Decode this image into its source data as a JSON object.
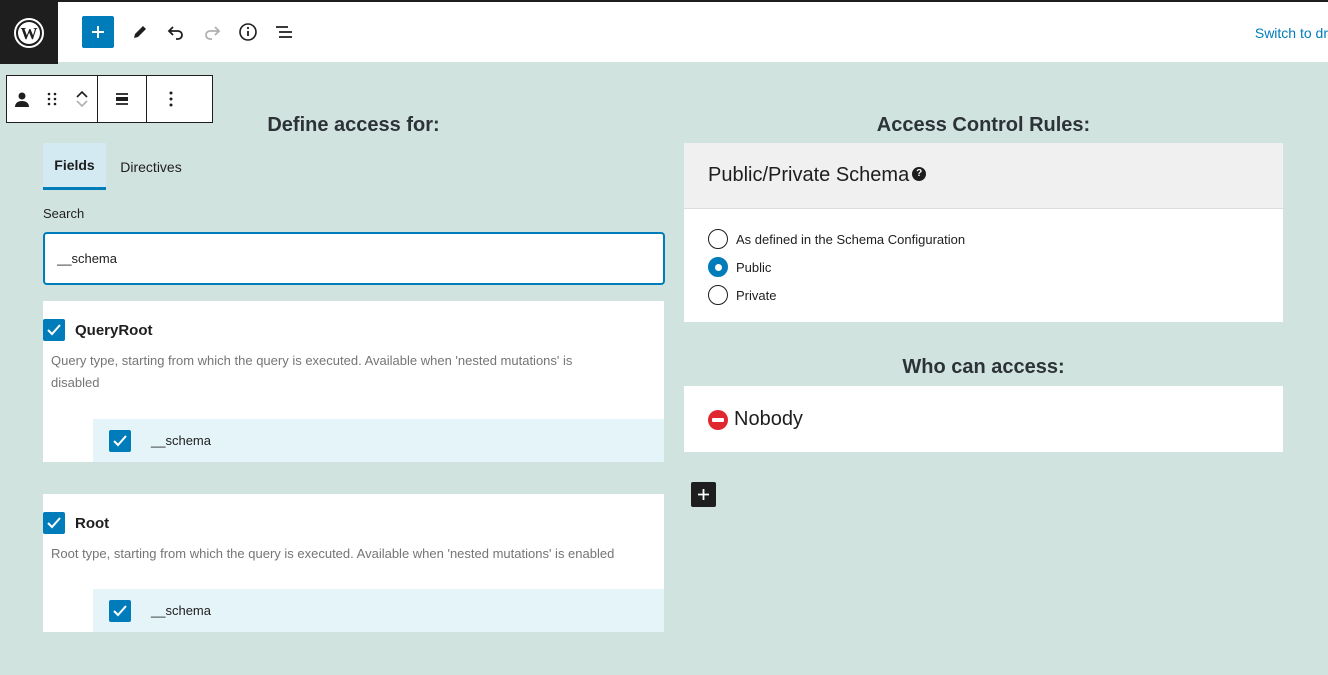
{
  "topbar": {
    "logo_icon": "wordpress-logo-icon",
    "tools": [
      "add-block-icon",
      "edit-pencil-icon",
      "undo-icon",
      "redo-icon",
      "info-icon",
      "list-view-icon"
    ],
    "switch_label": "Switch to dr"
  },
  "block_toolbar": {
    "icons": [
      "user-icon",
      "drag-handle-icon",
      "chevron-up-icon",
      "chevron-down-icon",
      "align-icon",
      "more-options-icon"
    ]
  },
  "left": {
    "heading": "Define access for:",
    "tabs": [
      {
        "label": "Fields",
        "active": true
      },
      {
        "label": "Directives",
        "active": false
      }
    ],
    "search": {
      "label": "Search",
      "value": "__schema"
    },
    "types": [
      {
        "name": "QueryRoot",
        "checked": true,
        "description": "Query type, starting from which the query is executed. Available when 'nested mutations' is disabled",
        "fields": [
          {
            "name": "__schema",
            "checked": true
          }
        ]
      },
      {
        "name": "Root",
        "checked": true,
        "description": "Root type, starting from which the query is executed. Available when 'nested mutations' is enabled",
        "fields": [
          {
            "name": "__schema",
            "checked": true
          }
        ]
      }
    ]
  },
  "right": {
    "heading": "Access Control Rules:",
    "schema_panel": {
      "title": "Public/Private Schema",
      "help_symbol": "?",
      "options": [
        {
          "label": "As defined in the Schema Configuration",
          "checked": false
        },
        {
          "label": "Public",
          "checked": true
        },
        {
          "label": "Private",
          "checked": false
        }
      ]
    },
    "who_heading": "Who can access:",
    "who_value": "Nobody",
    "who_icon": "no-entry-icon"
  },
  "colors": {
    "accent": "#007cba",
    "background": "#d1e3de",
    "dark": "#1e1e1e"
  }
}
